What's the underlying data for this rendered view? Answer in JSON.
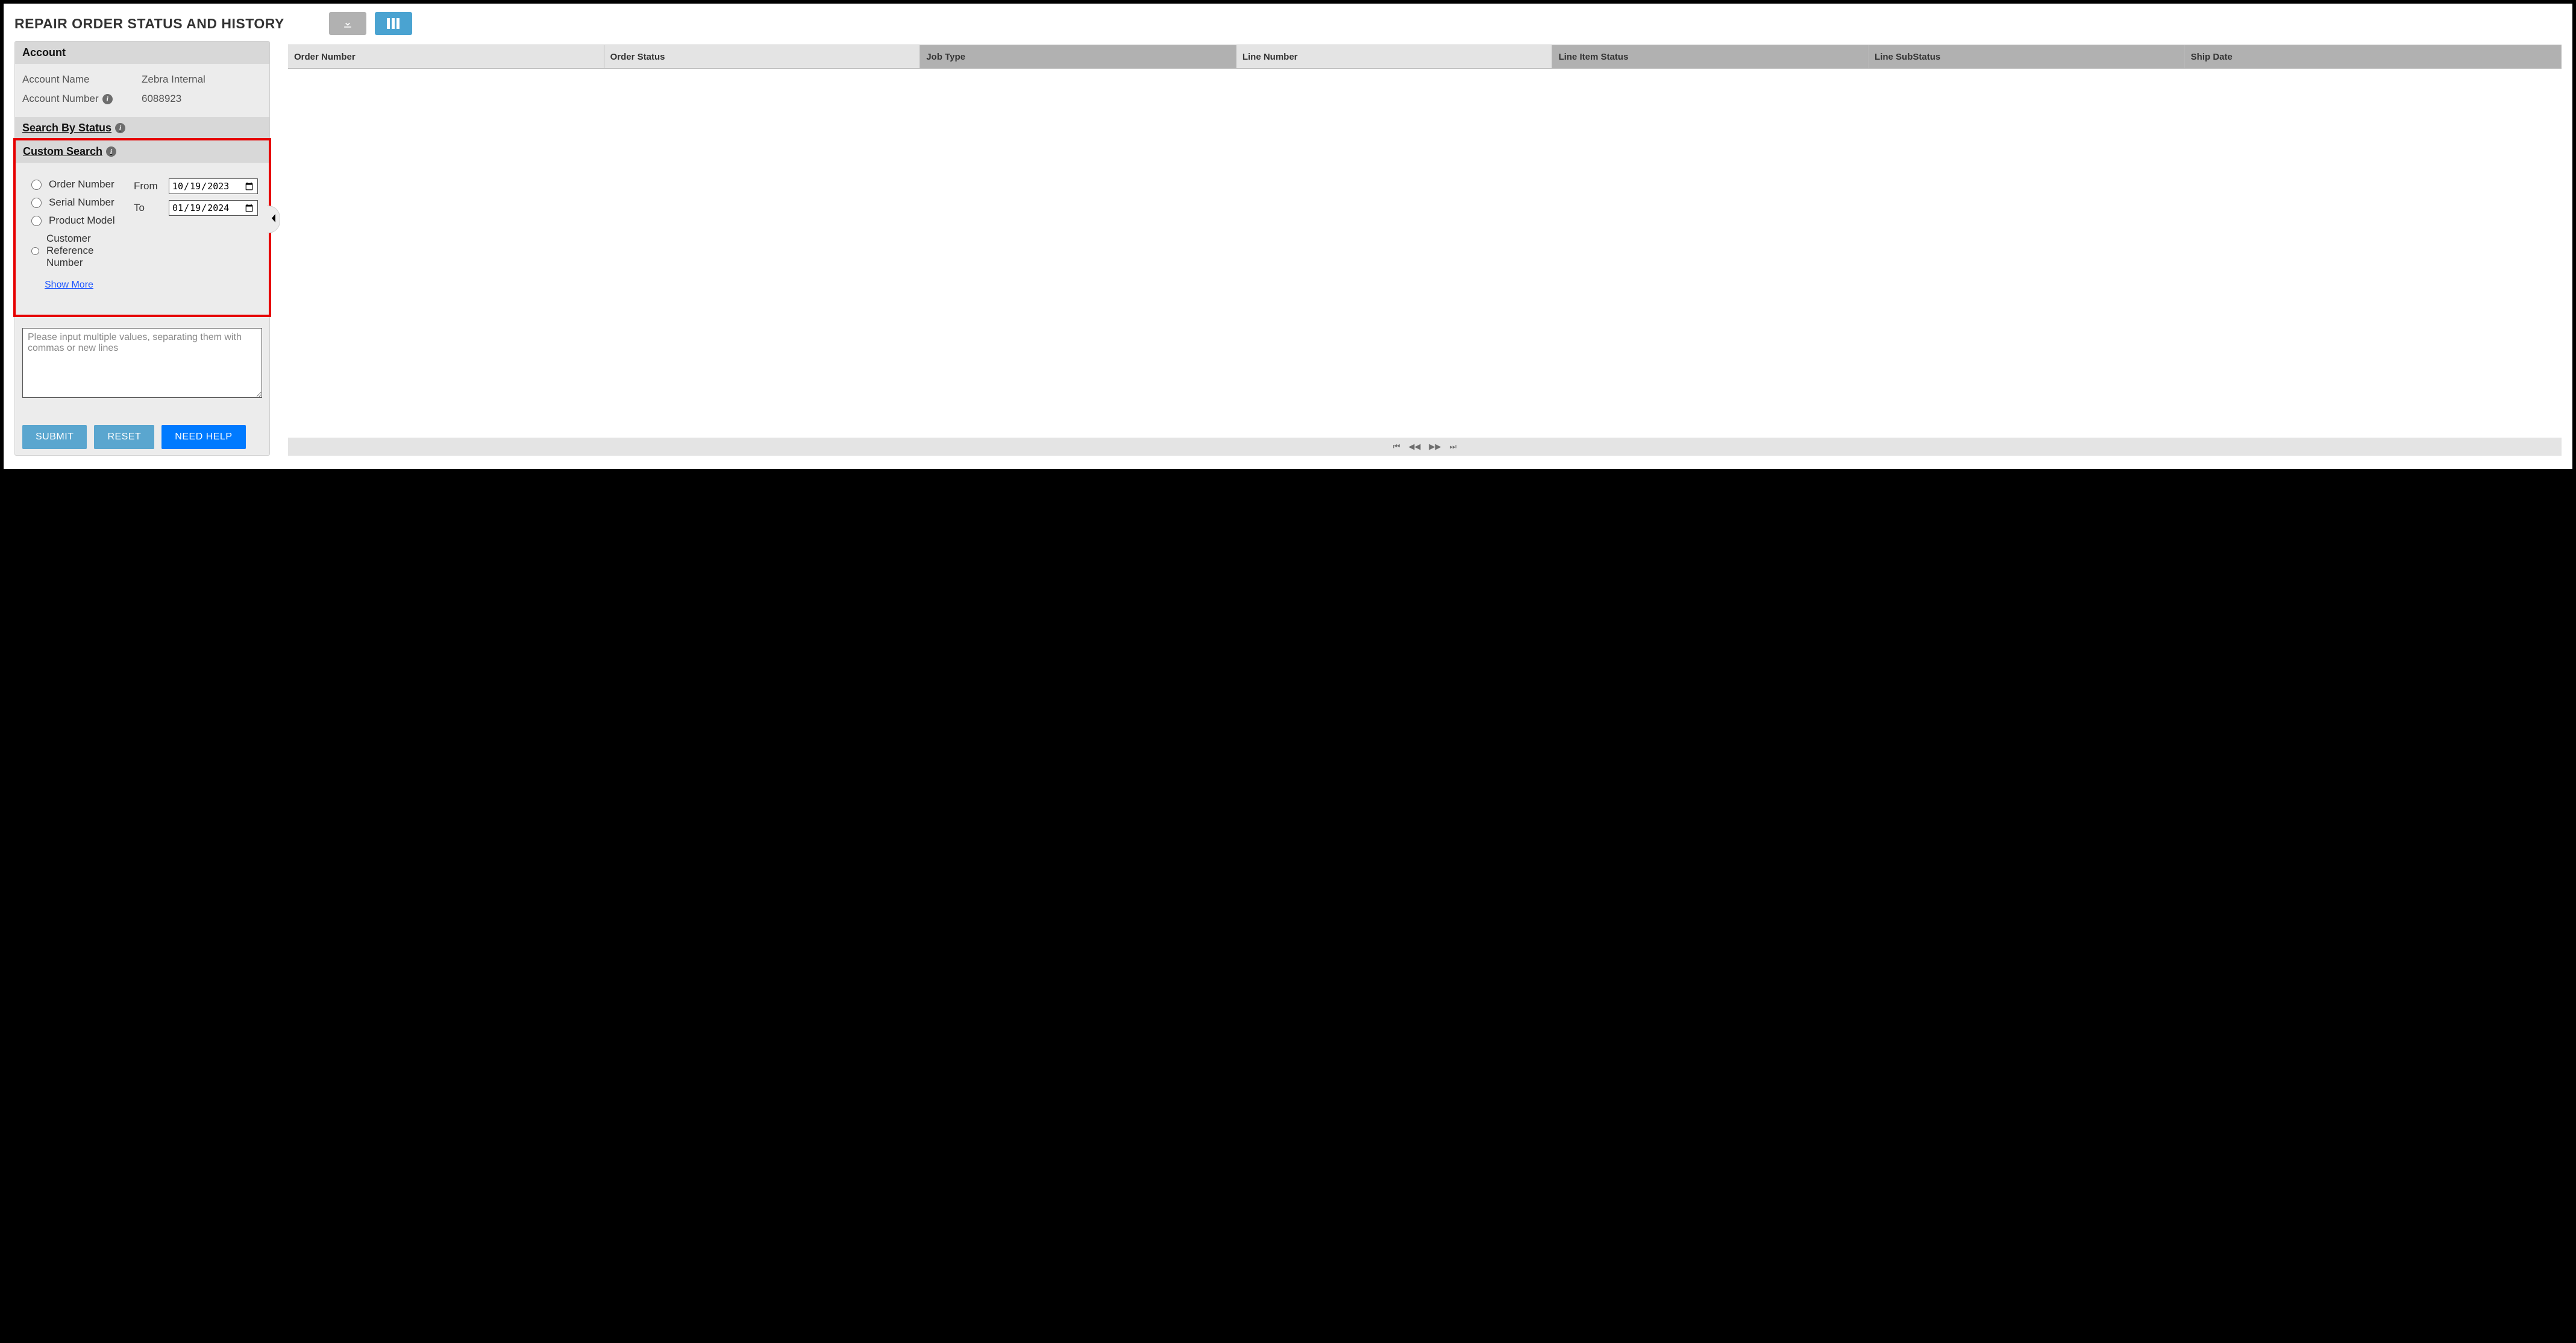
{
  "page": {
    "title": "REPAIR ORDER STATUS AND HISTORY"
  },
  "sidebar": {
    "account": {
      "heading": "Account",
      "name_label": "Account Name",
      "name_value": "Zebra Internal",
      "number_label": "Account Number",
      "number_value": "6088923"
    },
    "search_by_status": {
      "heading": "Search By Status"
    },
    "custom_search": {
      "heading": "Custom Search",
      "radios": {
        "order_number": "Order Number",
        "serial_number": "Serial Number",
        "product_model": "Product Model",
        "customer_reference": "Customer Reference Number"
      },
      "from_label": "From",
      "to_label": "To",
      "from_value": "2023-10-19",
      "to_value": "2024-01-19",
      "show_more": "Show More"
    },
    "multi_input_placeholder": "Please input multiple values, separating them with commas or new lines",
    "buttons": {
      "submit": "SUBMIT",
      "reset": "RESET",
      "need_help": "NEED HELP"
    }
  },
  "grid": {
    "columns": {
      "order_number": "Order Number",
      "order_status": "Order Status",
      "job_type": "Job Type",
      "line_number": "Line Number",
      "line_item_status": "Line Item Status",
      "line_substatus": "Line SubStatus",
      "ship_date": "Ship Date"
    }
  }
}
